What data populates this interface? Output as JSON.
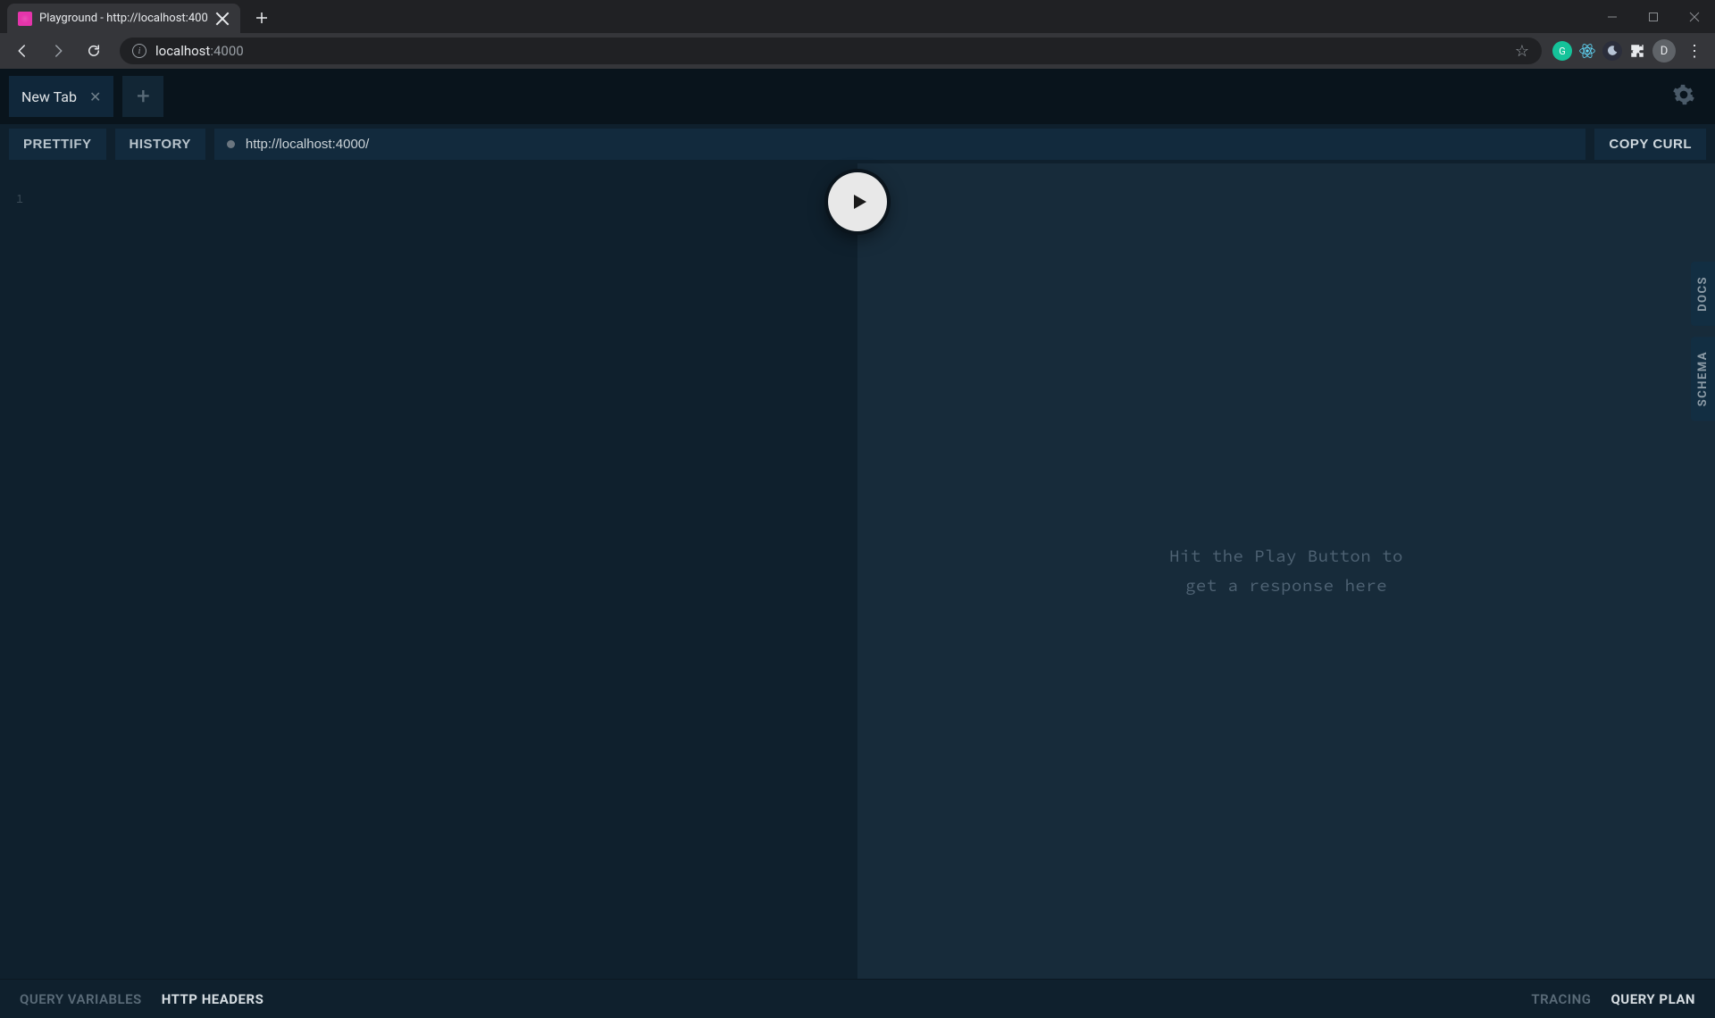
{
  "browser": {
    "tab_title": "Playground - http://localhost:400",
    "url_host": "localhost",
    "url_path": ":4000",
    "profile_letter": "D"
  },
  "playground": {
    "tab_label": "New Tab",
    "toolbar": {
      "prettify": "PRETTIFY",
      "history": "HISTORY",
      "endpoint": "http://localhost:4000/",
      "copy_curl": "COPY CURL"
    },
    "editor": {
      "first_line_number": "1"
    },
    "result_placeholder_line1": "Hit the Play Button to",
    "result_placeholder_line2": "get a response here",
    "side": {
      "docs": "DOCS",
      "schema": "SCHEMA"
    },
    "footer": {
      "query_variables": "QUERY VARIABLES",
      "http_headers": "HTTP HEADERS",
      "tracing": "TRACING",
      "query_plan": "QUERY PLAN"
    }
  }
}
